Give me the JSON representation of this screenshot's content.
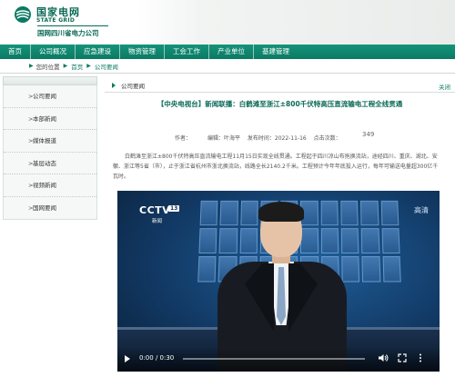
{
  "header": {
    "logo_cn": "国家电网",
    "logo_en": "STATE GRID",
    "logo_sub": "国网四川省电力公司"
  },
  "nav": {
    "items": [
      "首页",
      "公司概况",
      "应急建设",
      "物资管理",
      "工会工作",
      "产业单位",
      "基建管理"
    ]
  },
  "breadcrumb": {
    "label": "您的位置",
    "home": "首页",
    "current": "公司要闻"
  },
  "sidebar": {
    "items": [
      "公司要闻",
      "本部新闻",
      "媒体报道",
      "基层动态",
      "视频新闻",
      "国网要闻"
    ]
  },
  "section": {
    "title": "公司要闻",
    "more": "关闭"
  },
  "article": {
    "title": "【中央电视台】新闻联播：白鹤滩至浙江±800千伏特高压直流输电工程全线贯通",
    "author_label": "作者：",
    "author": "",
    "editor_label": "编辑：叶海平",
    "date_label": "发布时间：2022-11-16",
    "views_label": "点击次数：",
    "views": "349",
    "body": "白鹤滩至浙江±800千伏特高压直流输电工程11月15日实现全线贯通。工程起于四川凉山布拖换流站，途经四川、重庆、湖北、安徽、浙江等5省（市），止于浙江省杭州市浙北换流站，线路全长2140.2千米。工程预计今年年底投入运行，每年可输送电量超300亿千瓦时。"
  },
  "video": {
    "channel": "CCTV",
    "channel_num": "13",
    "channel_sub": "新闻",
    "corner": "高清",
    "time": "0:00 / 0:30",
    "progress": 0
  },
  "colors": {
    "brand": "#0b7a63",
    "title": "#0b6a57"
  }
}
